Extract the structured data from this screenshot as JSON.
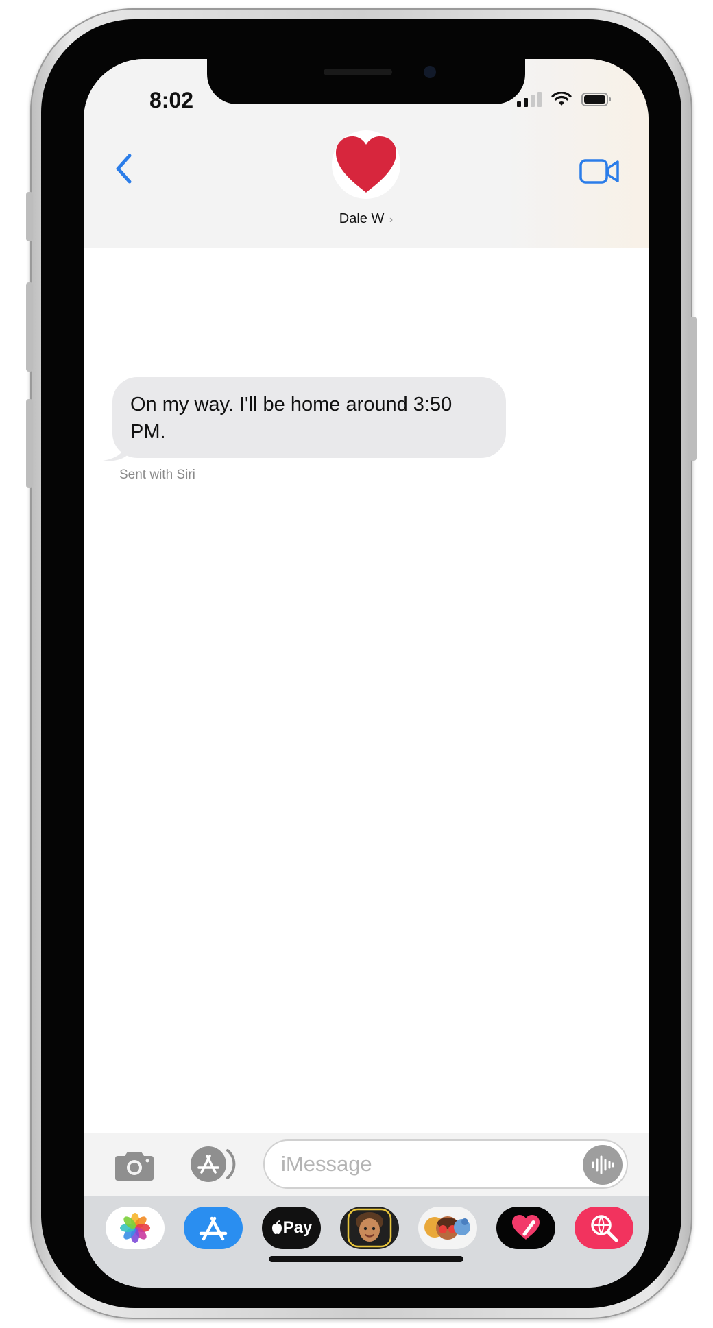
{
  "status_bar": {
    "time": "8:02",
    "icons": [
      "signal-icon",
      "wifi-icon",
      "battery-icon"
    ]
  },
  "header": {
    "back_icon": "chevron-left-icon",
    "contact_avatar": "red-heart-icon",
    "contact_name": "Dale W",
    "contact_chevron": "›",
    "facetime_icon": "video-camera-icon",
    "accent_color": "#2b7de9",
    "heart_color": "#d7263d"
  },
  "conversation": {
    "messages": [
      {
        "direction": "incoming",
        "text": "On my way. I'll be home around 3:50 PM.",
        "footer": "Sent with Siri",
        "bubble_color": "#e9e9eb"
      }
    ]
  },
  "input_bar": {
    "camera_icon": "camera-icon",
    "apps_icon": "app-store-icon",
    "placeholder": "iMessage",
    "value": "",
    "audio_icon": "waveform-icon"
  },
  "app_drawer": {
    "apps": [
      {
        "name": "photos",
        "icon": "photos-flower-icon"
      },
      {
        "name": "app-store",
        "icon": "app-store-icon"
      },
      {
        "name": "apple-pay",
        "label": "Pay",
        "icon": "apple-logo-icon"
      },
      {
        "name": "memoji",
        "icon": "memoji-face-icon"
      },
      {
        "name": "animoji",
        "icon": "animoji-face-icon"
      },
      {
        "name": "digital-touch",
        "icon": "heart-touch-icon"
      },
      {
        "name": "images",
        "icon": "globe-search-icon"
      }
    ]
  }
}
